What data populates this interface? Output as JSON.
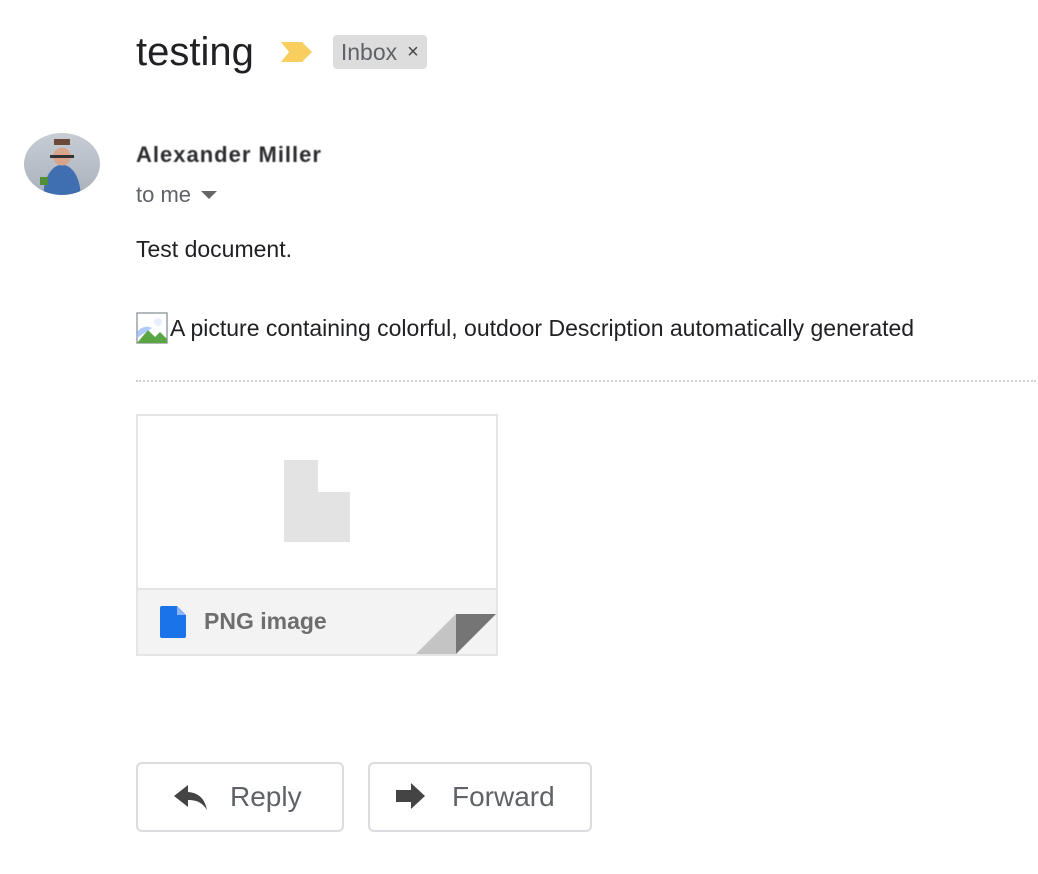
{
  "subject": "testing",
  "label": {
    "name": "Inbox",
    "remove_glyph": "×"
  },
  "colors": {
    "importance_marker": "#f8cf5f",
    "file_icon": "#1a73e8"
  },
  "sender": {
    "name": "Alexander Miller",
    "to_label": "to me"
  },
  "message": {
    "body": "Test document.",
    "image_alt": "A picture containing colorful, outdoor Description automatically generated"
  },
  "attachment": {
    "name": "PNG image",
    "icon": "file-icon"
  },
  "actions": {
    "reply_label": "Reply",
    "forward_label": "Forward"
  }
}
